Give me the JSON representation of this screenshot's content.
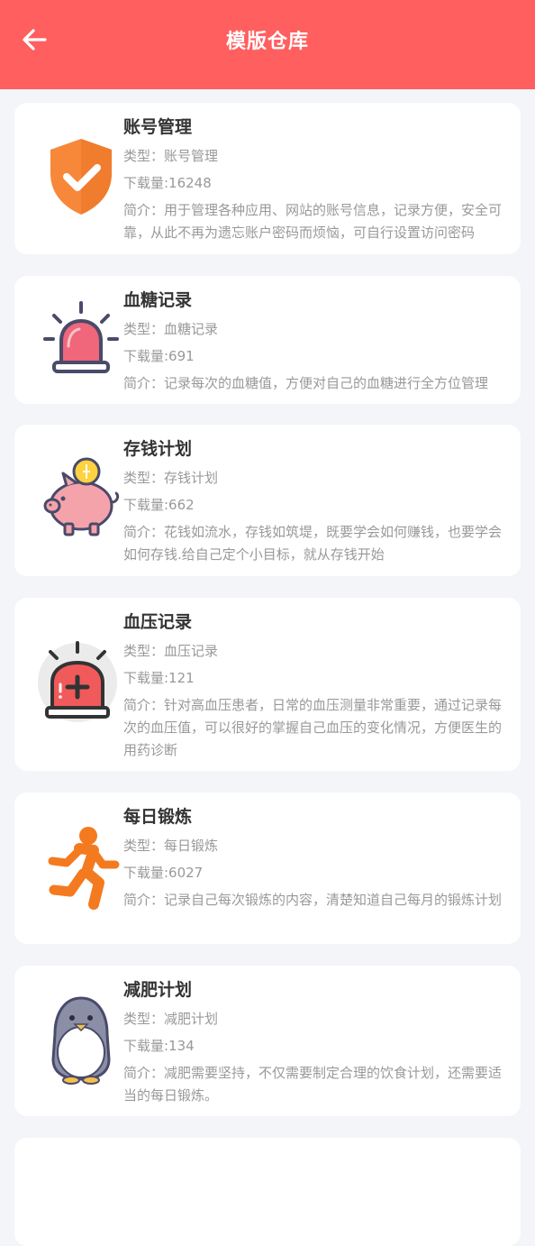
{
  "header": {
    "title": "模版仓库"
  },
  "templates": [
    {
      "name": "账号管理",
      "type_label": "类型：账号管理",
      "downloads_label": "下载量:16248",
      "desc": "简介：用于管理各种应用、网站的账号信息，记录方便，安全可靠，从此不再为遗忘账户密码而烦恼，可自行设置访问密码",
      "icon": "shield-check-icon"
    },
    {
      "name": "血糖记录",
      "type_label": "类型：血糖记录",
      "downloads_label": "下载量:691",
      "desc": "简介：记录每次的血糖值，方便对自己的血糖进行全方位管理",
      "icon": "alarm-light-icon"
    },
    {
      "name": "存钱计划",
      "type_label": "类型：存钱计划",
      "downloads_label": "下载量:662",
      "desc": "简介：花钱如流水，存钱如筑堤，既要学会如何赚钱，也要学会如何存钱.给自己定个小目标，就从存钱开始",
      "icon": "piggy-bank-icon"
    },
    {
      "name": "血压记录",
      "type_label": "类型：血压记录",
      "downloads_label": "下载量:121",
      "desc": "简介：针对高血压患者，日常的血压测量非常重要，通过记录每次的血压值，可以很好的掌握自己血压的变化情况，方便医生的用药诊断",
      "icon": "medical-alarm-icon"
    },
    {
      "name": "每日锻炼",
      "type_label": "类型：每日锻炼",
      "downloads_label": "下载量:6027",
      "desc": "简介：记录自己每次锻炼的内容，清楚知道自己每月的锻炼计划",
      "icon": "running-person-icon"
    },
    {
      "name": "减肥计划",
      "type_label": "类型：减肥计划",
      "downloads_label": "下载量:134",
      "desc": "简介：减肥需要坚持，不仅需要制定合理的饮食计划，还需要适当的每日锻炼。",
      "icon": "penguin-icon"
    },
    {
      "name": "",
      "type_label": "",
      "downloads_label": "",
      "desc": "",
      "icon": ""
    }
  ],
  "colors": {
    "header": "#ff5f5f",
    "background": "#f4f5f9"
  }
}
